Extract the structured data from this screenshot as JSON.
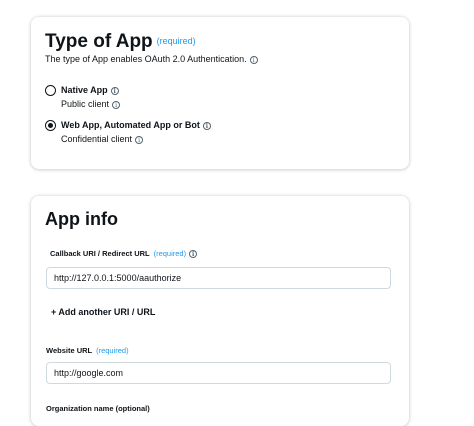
{
  "type_of_app": {
    "title": "Type of App",
    "required": "(required)",
    "subtitle": "The type of App enables OAuth 2.0 Authentication.",
    "info_glyph": "i",
    "options": [
      {
        "title": "Native App",
        "subtitle": "Public client",
        "selected": false
      },
      {
        "title": "Web App, Automated App or Bot",
        "subtitle": "Confidential client",
        "selected": true
      }
    ]
  },
  "app_info": {
    "title": "App info",
    "callback_label": "Callback URI / Redirect URL",
    "callback_required": "(required)",
    "callback_value": "http://127.0.0.1:5000/aauthorize",
    "add_uri_label": "+ Add another URI / URL",
    "website_label": "Website URL",
    "website_required": "(required)",
    "website_value": "http://google.com",
    "org_label": "Organization name (optional)"
  },
  "colors": {
    "accent": "#1d9bf0",
    "text": "#0f1419",
    "border": "#cfd9de"
  }
}
